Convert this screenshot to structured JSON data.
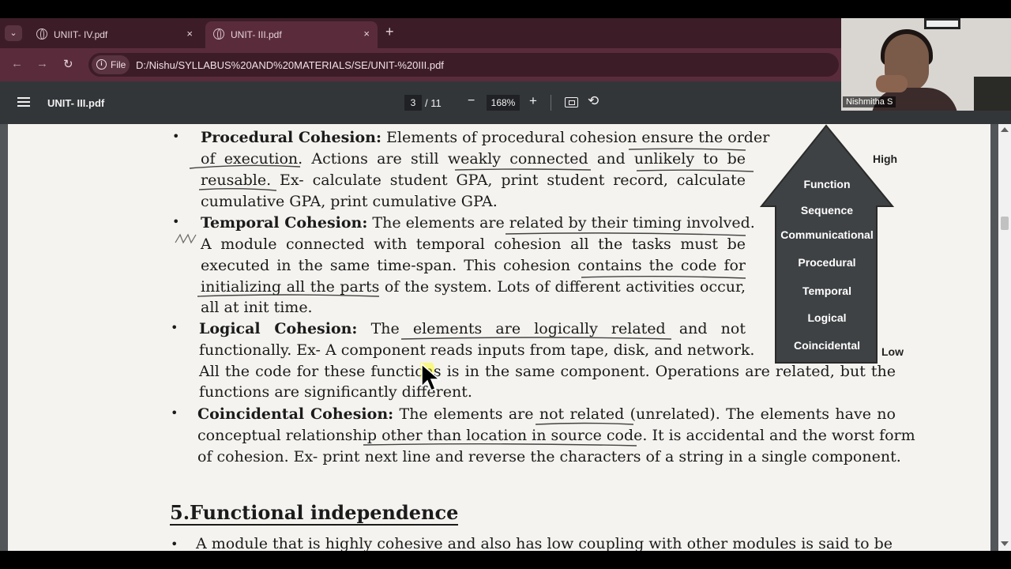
{
  "browser": {
    "tabs": [
      {
        "title": "UNIIT- IV.pdf",
        "close": "×"
      },
      {
        "title": "UNIT- III.pdf",
        "close": "×"
      }
    ],
    "new_tab": "+",
    "tab_list": "⌄",
    "nav": {
      "back": "←",
      "forward": "→",
      "reload": "↻"
    },
    "site_chip": {
      "info": "i",
      "label": "File"
    },
    "url": "D:/Nishu/SYLLABUS%20AND%20MATERIALS/SE/UNIT-%20III.pdf"
  },
  "pdf_toolbar": {
    "title": "UNIT- III.pdf",
    "current_page": "3",
    "total_pages": "/ 11",
    "zoom_out": "−",
    "zoom": "168%",
    "zoom_in": "+",
    "rotate": "⟲"
  },
  "document": {
    "procedural": {
      "term": "Procedural Cohesion:",
      "l1": "Elements of procedural cohesion ensure the order",
      "l2": "of execution. Actions are still weakly connected and unlikely to be",
      "l3": "reusable. Ex- calculate student GPA, print student record, calculate",
      "l4": "cumulative GPA, print cumulative GPA."
    },
    "temporal": {
      "term": "Temporal Cohesion:",
      "l1": "The elements are related by their timing involved.",
      "l2": "A module connected with temporal cohesion all the tasks must be",
      "l3": "executed in the same time-span. This cohesion contains the code for",
      "l4": "initializing all the parts of the system. Lots of different activities occur,",
      "l5": "all at init time."
    },
    "logical": {
      "term": "Logical Cohesion:",
      "l1": "The elements are logically related and not",
      "l2": "functionally. Ex- A component reads inputs from tape, disk, and network.",
      "l3": "All the code for these functions is in the same component. Operations are related, but the",
      "l4": "functions are significantly different."
    },
    "coincidental": {
      "term": "Coincidental Cohesion:",
      "l1": "The elements are not related (unrelated). The elements have no",
      "l2": "conceptual relationship other than location in source code. It is accidental and the worst form",
      "l3": "of cohesion. Ex- print next line and reverse the characters of a string in a single component."
    },
    "heading": "5.Functional independence",
    "next_line": "A module that is highly cohesive and also has low coupling with other modules is said to be",
    "bullet": "•"
  },
  "diagram": {
    "high": "High",
    "low": "Low",
    "levels": [
      "Function",
      "Sequence",
      "Communicational",
      "Procedural",
      "Temporal",
      "Logical",
      "Coincidental"
    ]
  },
  "webcam": {
    "name": "Nishmitha S"
  }
}
